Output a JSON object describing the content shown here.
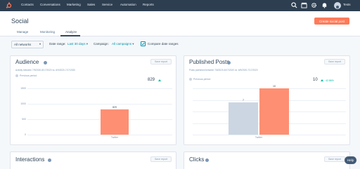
{
  "topnav": {
    "items": [
      "Contacts",
      "Conversations",
      "Marketing",
      "Sales",
      "Service",
      "Automation",
      "Reports"
    ],
    "account": "Tests"
  },
  "header": {
    "title": "Social",
    "create_button": "Create social post",
    "tabs": [
      "Manage",
      "Monitoring",
      "Analyze"
    ],
    "active_tab": "Analyze"
  },
  "filters": {
    "network": "All networks",
    "date_range_label": "Date range:",
    "date_range_value": "Last 30 days",
    "campaign_label": "Campaign:",
    "campaign_value": "All campaigns",
    "compare_label": "Compare date ranges",
    "compare_checked": true
  },
  "cards": {
    "audience": {
      "title": "Audience",
      "save": "Save report",
      "subtitle": "Activity between 7/9/2020-8/17/2020 vs. 6/9/2020-7/17/2020",
      "legend": "Previous period",
      "value": "829"
    },
    "published": {
      "title": "Published Posts",
      "save": "Save report",
      "subtitle": "Posts published between 7/8/2020-8/17/2020 vs. 6/9/2020-7/17/2020",
      "legend": "Previous period",
      "value": "10",
      "delta": "42.86%"
    },
    "interactions": {
      "title": "Interactions",
      "save": "Save report"
    },
    "clicks": {
      "title": "Clicks",
      "save": "Save report"
    }
  },
  "help_label": "Help",
  "chart_data": [
    {
      "type": "bar",
      "title": "Audience",
      "categories": [
        "Twitter"
      ],
      "series": [
        {
          "values": [
            829
          ]
        }
      ],
      "ylim": [
        0,
        1500
      ],
      "yticks": [
        0,
        500,
        1000,
        1500
      ],
      "bar_labels": [
        "829"
      ],
      "colors": [
        "#ff8f73"
      ]
    },
    {
      "type": "bar",
      "title": "Published Posts",
      "categories": [
        "Twitter"
      ],
      "series": [
        {
          "name": "Previous period",
          "values": [
            7
          ],
          "color": "#cbd6e2"
        },
        {
          "values": [
            10
          ],
          "color": "#ff8f73"
        }
      ],
      "ylim": [
        0,
        10
      ],
      "bar_labels": [
        "7",
        "10"
      ]
    }
  ]
}
